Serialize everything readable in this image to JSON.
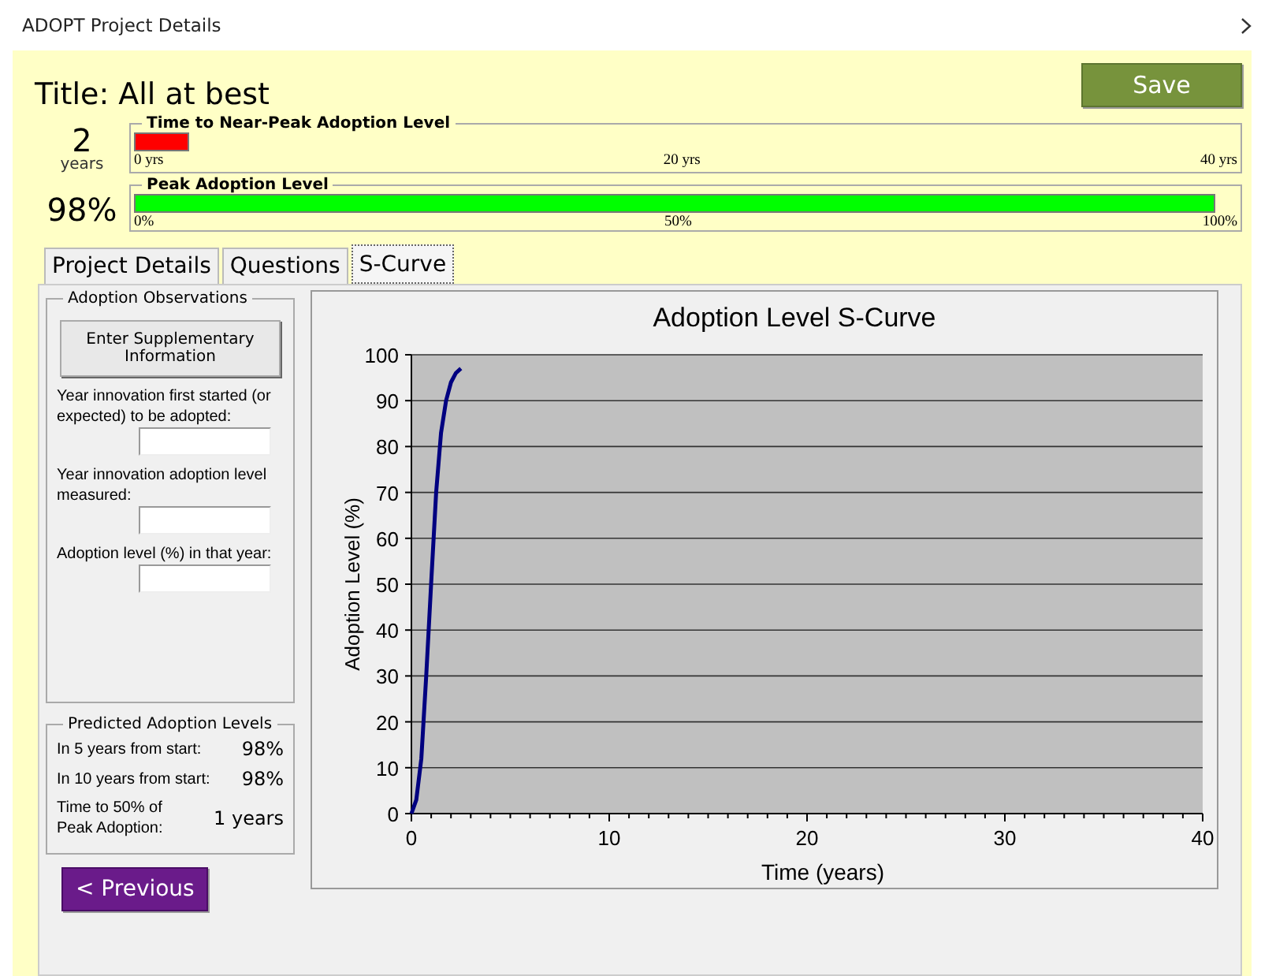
{
  "window": {
    "title": "ADOPT Project Details"
  },
  "header": {
    "title": "Title: All at best",
    "save_button": "Save"
  },
  "meters": [
    {
      "value": "2",
      "unit": "years",
      "label": "Time to Near-Peak Adoption Level",
      "level": 0.05,
      "color": "#ff0000",
      "ticks": [
        "0 yrs",
        "20 yrs",
        "40 yrs"
      ]
    },
    {
      "value": "98%",
      "label": "Peak Adoption Level",
      "level": 0.98,
      "color": "#00ff00",
      "ticks": [
        "0%",
        "50%",
        "100%"
      ]
    }
  ],
  "tabs": [
    {
      "label": "Project Details",
      "selected": false
    },
    {
      "label": "Questions",
      "selected": false
    },
    {
      "label": "S-Curve",
      "selected": true
    }
  ],
  "observations": {
    "title": "Adoption Observations",
    "button": "Enter Supplementary Information",
    "fields": [
      {
        "label": "Year innovation first started (or expected) to be adopted:"
      },
      {
        "label": "Year innovation adoption level measured:"
      },
      {
        "label": "Adoption level (%) in that year:"
      }
    ]
  },
  "predicted": {
    "title": "Predicted Adoption Levels",
    "rows": [
      {
        "label": "In 5 years from start:",
        "value": "98%"
      },
      {
        "label": "In 10 years from start:",
        "value": "98%"
      },
      {
        "label": "Time to 50% of Peak Adoption:",
        "value": "1 years"
      }
    ]
  },
  "chart_data": {
    "type": "line",
    "title": "Adoption Level S-Curve",
    "xlabel": "Time (years)",
    "ylabel": "Adoption Level (%)",
    "x": [
      0,
      0.25,
      0.5,
      0.75,
      1,
      1.25,
      1.5,
      1.75,
      2,
      2.25,
      2.5
    ],
    "series": [
      {
        "color": "#000080",
        "values": [
          0,
          3,
          12,
          30,
          50,
          70,
          83,
          90,
          94,
          96,
          97
        ]
      }
    ],
    "grid": true,
    "xlim": [
      0,
      40
    ],
    "ylim": [
      0,
      100
    ],
    "xticks": [
      0,
      10,
      20,
      30,
      40
    ],
    "yticks": [
      0,
      10,
      20,
      30,
      40,
      50,
      60,
      70,
      80,
      90,
      100
    ]
  },
  "previous_button": "< Previous"
}
